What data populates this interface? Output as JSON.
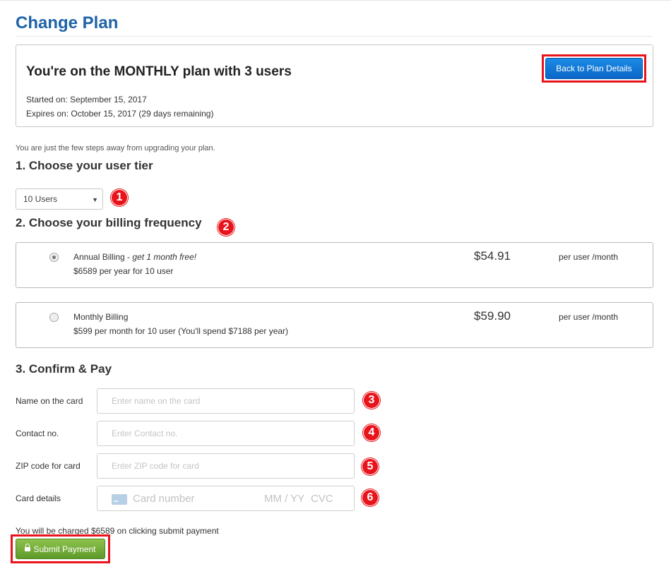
{
  "page": {
    "title": "Change Plan"
  },
  "plan": {
    "heading": "You're on the MONTHLY plan with 3 users",
    "started": "Started on: September 15, 2017",
    "expires": "Expires on: October 15, 2017 (29 days remaining)",
    "back_button": "Back to Plan Details"
  },
  "steps_note": "You are just the few steps away from upgrading your plan.",
  "step1": {
    "heading": "1. Choose your user tier",
    "selected_tier": "10 Users",
    "badge": "1"
  },
  "step2": {
    "heading": "2. Choose your billing frequency",
    "badge": "2",
    "options": [
      {
        "title": "Annual Billing",
        "title_sep": " - ",
        "promo": "get 1 month free!",
        "sub": "$6589 per year for 10 user",
        "price": "$54.91",
        "unit": "per user /month",
        "checked": true
      },
      {
        "title": "Monthly Billing",
        "title_sep": "",
        "promo": "",
        "sub": "$599 per month for 10 user (You'll spend $7188 per year)",
        "price": "$59.90",
        "unit": "per user /month",
        "checked": false
      }
    ]
  },
  "step3": {
    "heading": "3. Confirm & Pay",
    "fields": {
      "name": {
        "label": "Name on the card",
        "placeholder": "Enter name on the card",
        "badge": "3"
      },
      "contact": {
        "label": "Contact no.",
        "placeholder": "Enter Contact no.",
        "badge": "4"
      },
      "zip": {
        "label": "ZIP code for card",
        "placeholder": "Enter ZIP code for card",
        "badge": "5"
      },
      "card": {
        "label": "Card details",
        "number_placeholder": "Card number",
        "expiry_placeholder": "MM / YY",
        "cvc_placeholder": "CVC",
        "badge": "6"
      }
    }
  },
  "charge_note": "You will be charged $6589 on clicking submit payment",
  "submit_button": "Submit Payment",
  "colors": {
    "title": "#1e63a8",
    "annotation_red": "#e8141b",
    "primary_blue": "#0a66c7",
    "submit_green": "#6da535"
  }
}
